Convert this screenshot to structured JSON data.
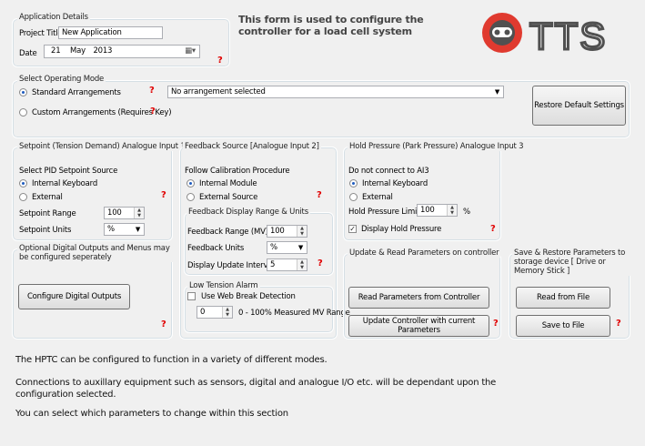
{
  "app_details": {
    "legend": "Application Details",
    "project_title_label": "Project Title",
    "project_title_value": "New Application",
    "date_label": "Date",
    "date_day": "21",
    "date_month": "May",
    "date_year": "2013"
  },
  "header_text": "This form is used to configure the controller for a load cell system",
  "logo_text": "TTS",
  "operating_mode": {
    "legend": "Select Operating Mode",
    "standard": "Standard Arrangements",
    "custom": "Custom Arrangements (Requires Key)",
    "arrangement_value": "No arrangement selected",
    "restore_button": "Restore Default Settings"
  },
  "setpoint": {
    "legend": "Setpoint (Tension Demand)  Analogue Input 1",
    "source_label": "Select PID Setpoint Source",
    "internal": "Internal Keyboard",
    "external": "External",
    "range_label": "Setpoint Range",
    "range_value": "100",
    "units_label": "Setpoint Units",
    "units_value": "%"
  },
  "feedback": {
    "legend": "Feedback Source [Analogue Input 2]",
    "procedure_label": "Follow Calibration Procedure",
    "internal": "Internal Module",
    "external": "External Source",
    "display_legend": "Feedback Display Range & Units",
    "range_label": "Feedback Range (MV)",
    "range_value": "100",
    "units_label": "Feedback Units",
    "units_value": "%",
    "interval_label": "Display Update Interval",
    "interval_value": "5"
  },
  "hold": {
    "legend": "Hold Pressure (Park Pressure) Analogue Input 3",
    "note": "Do not connect to AI3",
    "internal": "Internal Keyboard",
    "external": "External",
    "limit_label": "Hold Pressure Limit",
    "limit_value": "100",
    "limit_unit": "%",
    "display_label": "Display Hold Pressure"
  },
  "digital": {
    "legend": "Optional Digital Outputs and Menus may be configured seperately",
    "button": "Configure Digital Outputs"
  },
  "alarm": {
    "legend": "Low Tension Alarm",
    "web_break": "Use Web Break Detection",
    "value": "0",
    "range_text": "0 - 100% Measured MV Range"
  },
  "update": {
    "legend": "Update & Read Parameters on controller",
    "read_button": "Read Parameters from Controller",
    "update_button": "Update Controller with current Parameters"
  },
  "storage": {
    "legend": "Save & Restore Parameters to storage device [ Drive or Memory Stick ]",
    "read_button": "Read from File",
    "save_button": "Save to File"
  },
  "info": {
    "line1": "The HPTC can be configured to function in a variety of different modes.",
    "line2": "Connections to auxillary equipment such as sensors, digital and analogue I/O etc. will be dependant upon the",
    "line3": "configuration selected.",
    "line4": "You can select which parameters to change within this section"
  },
  "help_mark": "?",
  "colors": {
    "accent_red": "#e00000",
    "logo_red": "#e03a2f",
    "logo_gray": "#505050"
  }
}
